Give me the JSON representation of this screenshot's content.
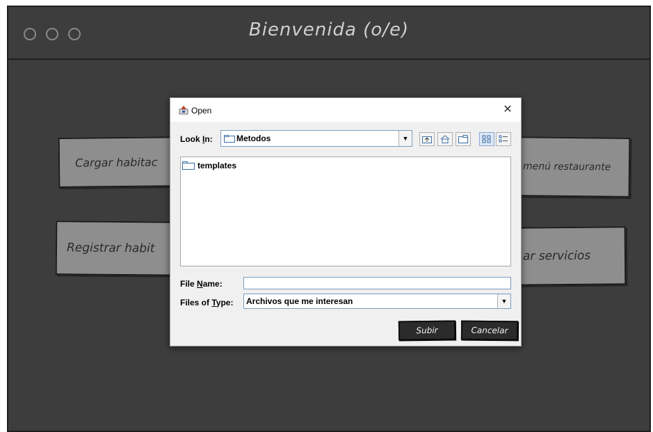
{
  "background": {
    "window_title": "Bienvenida (o/e)",
    "buttons": {
      "load_rooms": "Cargar habitac",
      "restaurant_menu": "menú restaurante",
      "register_rooms": "Registrar habit",
      "services": "ar servicios"
    }
  },
  "dialog": {
    "title": "Open",
    "look_in_label_pre": "Look ",
    "look_in_label_u": "I",
    "look_in_label_post": "n:",
    "look_in_value": "Metodos",
    "files": [
      {
        "name": "templates",
        "icon": "folder-icon"
      }
    ],
    "file_name_label_pre": "File ",
    "file_name_label_u": "N",
    "file_name_label_post": "ame:",
    "file_name_value": "",
    "files_of_type_label_pre": "Files of ",
    "files_of_type_label_u": "T",
    "files_of_type_label_post": "ype:",
    "files_of_type_value": "Archivos que me interesan",
    "submit_label": "Subir",
    "cancel_label": "Cancelar"
  },
  "colors": {
    "sketch_background": "#3d3d3d",
    "sketch_button": "#8e8e8e",
    "dialog_background": "#f0f0f0"
  }
}
